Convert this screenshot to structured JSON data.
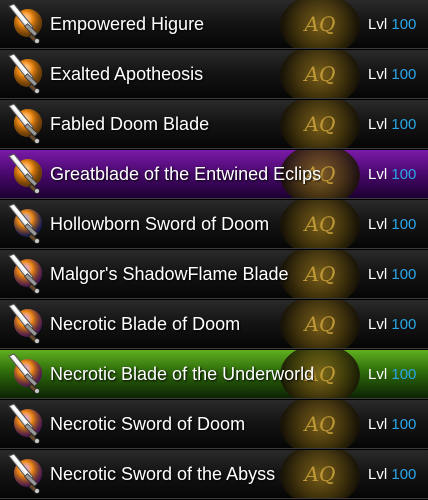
{
  "items": [
    {
      "name": "Empowered Higure",
      "level_label": "Lvl",
      "level": "100",
      "orb": "orange",
      "highlight": "none"
    },
    {
      "name": "Exalted Apotheosis",
      "level_label": "Lvl",
      "level": "100",
      "orb": "orange",
      "highlight": "none"
    },
    {
      "name": "Fabled Doom Blade",
      "level_label": "Lvl",
      "level": "100",
      "orb": "orange",
      "highlight": "none"
    },
    {
      "name": "Greatblade of the Entwined Eclips",
      "level_label": "Lvl",
      "level": "100",
      "orb": "orange",
      "highlight": "purple"
    },
    {
      "name": "Hollowborn Sword of Doom",
      "level_label": "Lvl",
      "level": "100",
      "orb": "blue",
      "highlight": "none"
    },
    {
      "name": "Malgor's ShadowFlame Blade",
      "level_label": "Lvl",
      "level": "100",
      "orb": "violet",
      "highlight": "none"
    },
    {
      "name": "Necrotic Blade of Doom",
      "level_label": "Lvl",
      "level": "100",
      "orb": "violet",
      "highlight": "none"
    },
    {
      "name": "Necrotic Blade of the Underworld",
      "level_label": "Lvl",
      "level": "100",
      "orb": "violet",
      "highlight": "green"
    },
    {
      "name": "Necrotic Sword of Doom",
      "level_label": "Lvl",
      "level": "100",
      "orb": "violet",
      "highlight": "none"
    },
    {
      "name": "Necrotic Sword of the Abyss",
      "level_label": "Lvl",
      "level": "100",
      "orb": "violet",
      "highlight": "none"
    }
  ],
  "icon": "sword-icon",
  "emblem_text": "AQ",
  "colors": {
    "orange": "#f28a12",
    "blue": "#2d3bd6",
    "violet": "#b13ad0",
    "level_value": "#2aa6e6",
    "purple_row": "#6a1796",
    "green_row": "#3d8a12"
  }
}
